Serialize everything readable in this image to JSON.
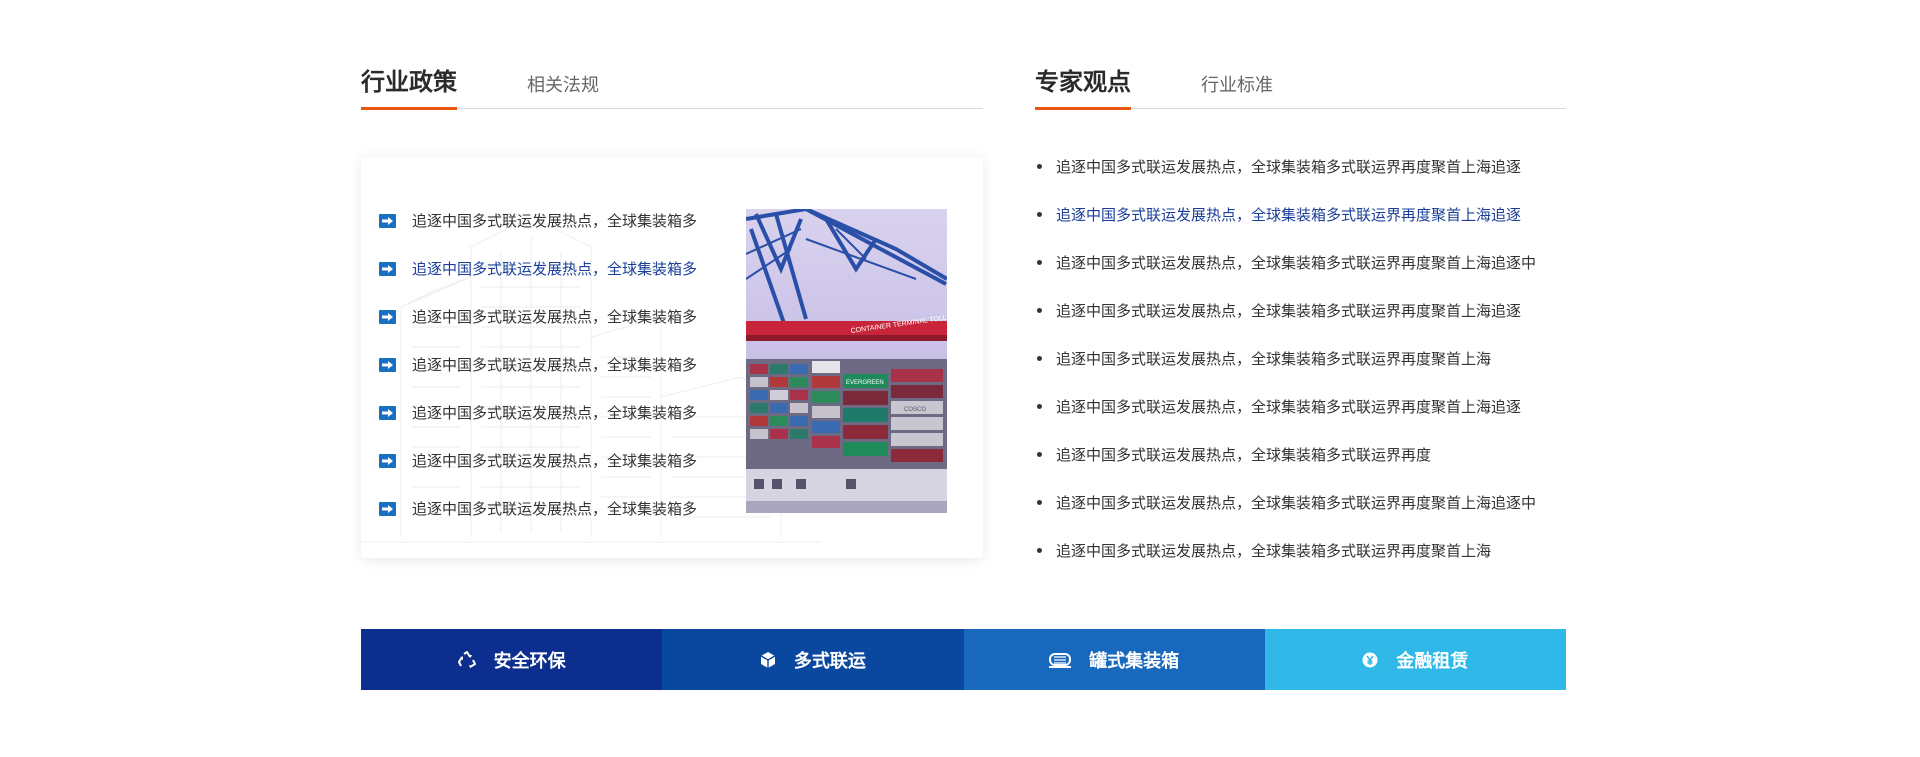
{
  "policy_tabs": {
    "active": "行业政策",
    "inactive": "相关法规"
  },
  "expert_tabs": {
    "active": "专家观点",
    "inactive": "行业标准"
  },
  "left_items": [
    "追逐中国多式联运发展热点，全球集装箱多",
    "追逐中国多式联运发展热点，全球集装箱多",
    "追逐中国多式联运发展热点，全球集装箱多",
    "追逐中国多式联运发展热点，全球集装箱多",
    "追逐中国多式联运发展热点，全球集装箱多",
    "追逐中国多式联运发展热点，全球集装箱多",
    "追逐中国多式联运发展热点，全球集装箱多"
  ],
  "left_highlight_index": 1,
  "right_items": [
    "追逐中国多式联运发展热点，全球集装箱多式联运界再度聚首上海追逐",
    "追逐中国多式联运发展热点，全球集装箱多式联运界再度聚首上海追逐",
    "追逐中国多式联运发展热点，全球集装箱多式联运界再度聚首上海追逐中",
    "追逐中国多式联运发展热点，全球集装箱多式联运界再度聚首上海追逐",
    "追逐中国多式联运发展热点，全球集装箱多式联运界再度聚首上海",
    "追逐中国多式联运发展热点，全球集装箱多式联运界再度聚首上海追逐",
    "追逐中国多式联运发展热点，全球集装箱多式联运界再度",
    "追逐中国多式联运发展热点，全球集装箱多式联运界再度聚首上海追逐中",
    "追逐中国多式联运发展热点，全球集装箱多式联运界再度聚首上海"
  ],
  "right_highlight_index": 1,
  "image_text": {
    "crane_sign": "CONTAINER TERMINAL TOLLERORT",
    "container_brand_1": "EVERGREEN",
    "container_brand_2": "COSCO"
  },
  "bottom_bar": [
    {
      "label": "安全环保",
      "icon": "recycle-icon",
      "color": "#0c2e8e"
    },
    {
      "label": "多式联运",
      "icon": "box-icon",
      "color": "#0a48a0"
    },
    {
      "label": "罐式集装箱",
      "icon": "tank-container-icon",
      "color": "#1869be"
    },
    {
      "label": "金融租赁",
      "icon": "yen-coin-icon",
      "color": "#30b9e8"
    }
  ],
  "colors": {
    "accent_orange": "#e8570e",
    "link_blue": "#1a3e9a",
    "arrow_blue": "#1a6fc4"
  }
}
